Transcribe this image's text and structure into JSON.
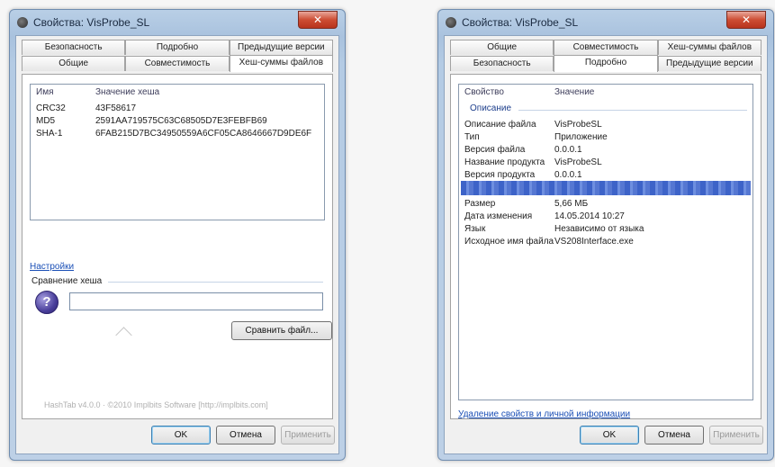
{
  "left_window": {
    "title": "Свойства: VisProbe_SL",
    "close_label": "✕",
    "tabs_back": [
      "Безопасность",
      "Подробно",
      "Предыдущие версии"
    ],
    "tabs_front": [
      "Общие",
      "Совместимость",
      "Хеш-суммы файлов"
    ],
    "active_tab": "Хеш-суммы файлов",
    "hash_list": {
      "col_name": "Имя",
      "col_value": "Значение хеша",
      "rows": [
        {
          "name": "CRC32",
          "value": "43F58617"
        },
        {
          "name": "MD5",
          "value": "2591AA719575C63C68505D7E3FEBFB69"
        },
        {
          "name": "SHA-1",
          "value": "6FAB215D7BC34950559A6CF05CA8646667D9DE6F"
        }
      ]
    },
    "settings_link": "Настройки",
    "compare_label": "Сравнение хеша",
    "compare_value": "",
    "compare_file_button": "Сравнить файл...",
    "footer": "HashTab v4.0.0 · ©2010 Implbits Software [http://implbits.com]",
    "ok": "OK",
    "cancel": "Отмена",
    "apply": "Применить"
  },
  "right_window": {
    "title": "Свойства: VisProbe_SL",
    "close_label": "✕",
    "tabs_back": [
      "Общие",
      "Совместимость",
      "Хеш-суммы файлов"
    ],
    "tabs_front": [
      "Безопасность",
      "Подробно",
      "Предыдущие версии"
    ],
    "active_tab": "Подробно",
    "details": {
      "col_property": "Свойство",
      "col_value": "Значение",
      "section": "Описание",
      "rows": [
        {
          "name": "Описание файла",
          "value": "VisProbeSL"
        },
        {
          "name": "Тип",
          "value": "Приложение"
        },
        {
          "name": "Версия файла",
          "value": "0.0.0.1"
        },
        {
          "name": "Название продукта",
          "value": "VisProbeSL"
        },
        {
          "name": "Версия продукта",
          "value": "0.0.0.1"
        },
        {
          "name": "",
          "value": ""
        },
        {
          "name": "Размер",
          "value": "5,66 МБ"
        },
        {
          "name": "Дата изменения",
          "value": "14.05.2014 10:27"
        },
        {
          "name": "Язык",
          "value": "Независимо от языка"
        },
        {
          "name": "Исходное имя файла",
          "value": "VS208Interface.exe"
        }
      ]
    },
    "remove_link": "Удаление свойств и личной информации",
    "ok": "OK",
    "cancel": "Отмена",
    "apply": "Применить"
  }
}
